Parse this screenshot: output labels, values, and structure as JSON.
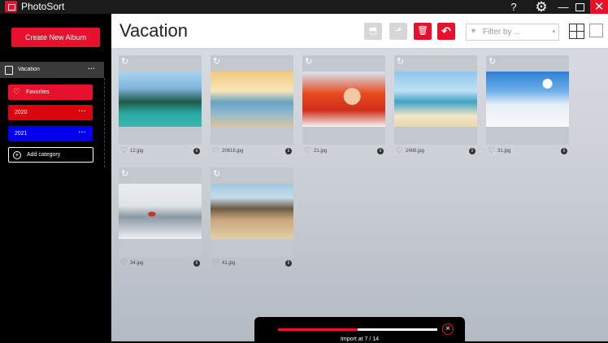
{
  "app": {
    "title": "PhotoSort"
  },
  "titlebar": {
    "help": "?",
    "settings": "⚙",
    "minimize": "—",
    "close": "✕"
  },
  "sidebar": {
    "create_label": "Create New Album",
    "album": {
      "label": "Vacation",
      "more": "···"
    },
    "categories": [
      {
        "label": "Favorites",
        "color": "#e8112d"
      },
      {
        "label": "2020",
        "more": "···",
        "color": "#d8070f"
      },
      {
        "label": "2021",
        "more": "···",
        "color": "#0000ee"
      }
    ],
    "add_label": "Add category"
  },
  "header": {
    "title": "Vacation",
    "filter_placeholder": "Filter by ...",
    "buttons": [
      "import-icon",
      "export-icon",
      "delete-icon",
      "undo-icon"
    ]
  },
  "photos": [
    {
      "name": "12.jpg"
    },
    {
      "name": "20616.jpg"
    },
    {
      "name": "21.jpg"
    },
    {
      "name": "2486.jpg"
    },
    {
      "name": "31.jpg"
    },
    {
      "name": "34.jpg"
    },
    {
      "name": "41.jpg"
    }
  ],
  "progress": {
    "text": "Import at 7 / 14",
    "fraction": 0.5
  },
  "colors": {
    "accent": "#e8112d",
    "sidebar": "#000000",
    "category_2021": "#0000ee"
  }
}
